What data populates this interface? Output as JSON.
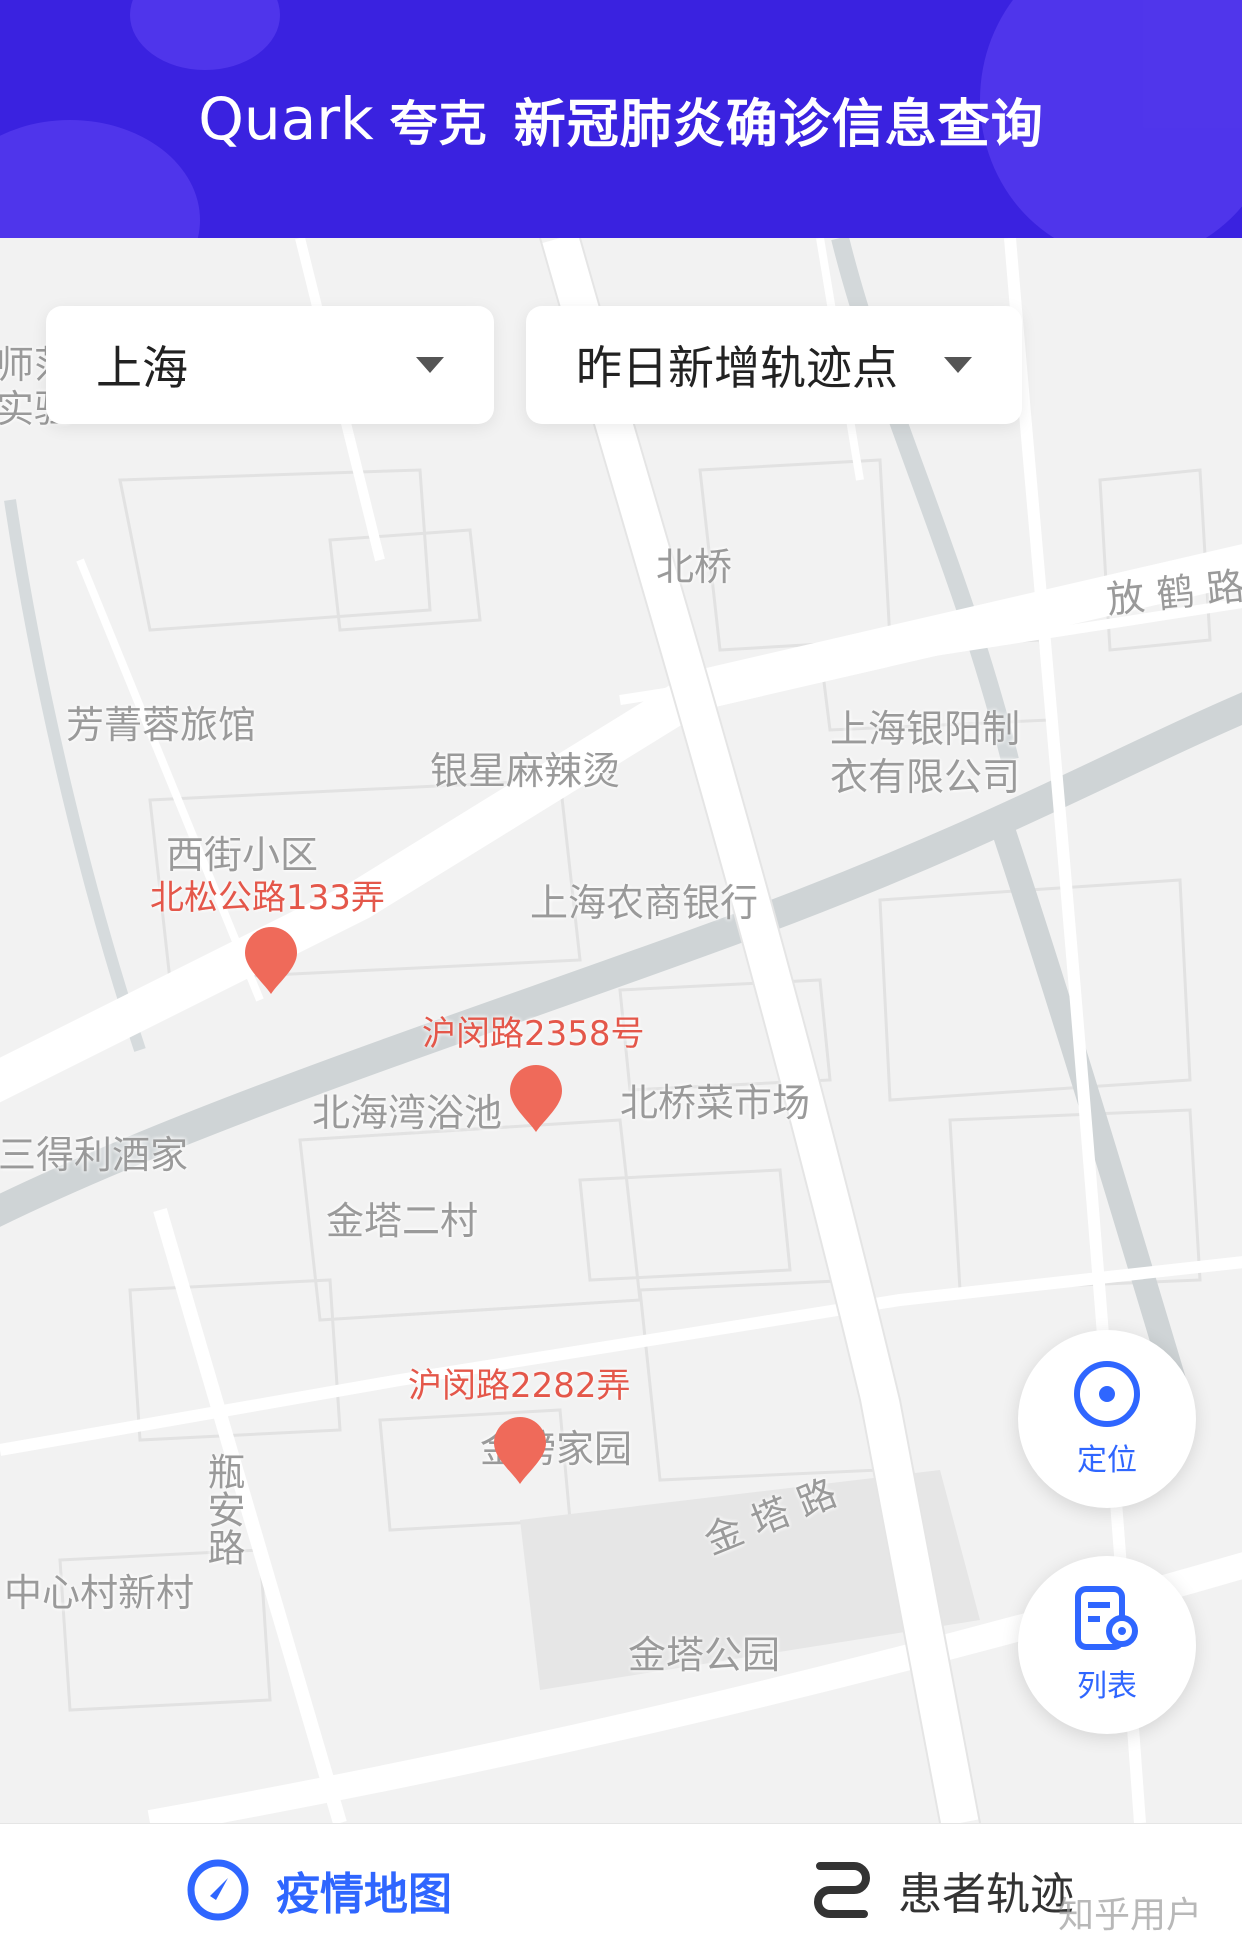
{
  "header": {
    "brand": "Quark",
    "brand_cn": "夸克",
    "title": "新冠肺炎确诊信息查询"
  },
  "filters": {
    "city": "上海",
    "range": "昨日新增轨迹点"
  },
  "map": {
    "labels": {
      "edge_top": "师范",
      "edge_bottom": "实验",
      "beiqiao": "北桥",
      "fanghe_road": "放 鹤 路",
      "fangjingrong_hotel": "芳菁蓉旅馆",
      "yinxing_malatang": "银星麻辣烫",
      "yinyang_garment_1": "上海银阳制",
      "yinyang_garment_2": "衣有限公司",
      "xijie_community": "西街小区",
      "rural_bank": "上海农商银行",
      "beihaiwan_bath": "北海湾浴池",
      "beiqiao_market": "北桥菜市场",
      "sandeli_restaurant": "三得利酒家",
      "jinta_ercun": "金塔二村",
      "jinbang_garden": "金榜家园",
      "ping_an_road": "瓶安路",
      "zhongxincun": "中心村新村",
      "jinta_road": "金 塔 路",
      "jinta_park": "金塔公园"
    },
    "pins": [
      {
        "label": "北松公路133弄"
      },
      {
        "label": "沪闵路2358号"
      },
      {
        "label": "沪闵路2282弄"
      }
    ]
  },
  "fab": {
    "locate": {
      "label": "定位",
      "icon": "target-icon"
    },
    "list": {
      "label": "列表",
      "icon": "list-location-icon"
    }
  },
  "tabs": [
    {
      "label": "疫情地图",
      "icon": "compass-icon",
      "active": true
    },
    {
      "label": "患者轨迹",
      "icon": "route-icon",
      "active": false
    }
  ],
  "watermark": "知乎用户",
  "colors": {
    "header": "#3a22e0",
    "accent": "#2f66ff",
    "pin": "#ef6a5a",
    "pin_label": "#e4574a",
    "inactive_tab": "#333333"
  }
}
